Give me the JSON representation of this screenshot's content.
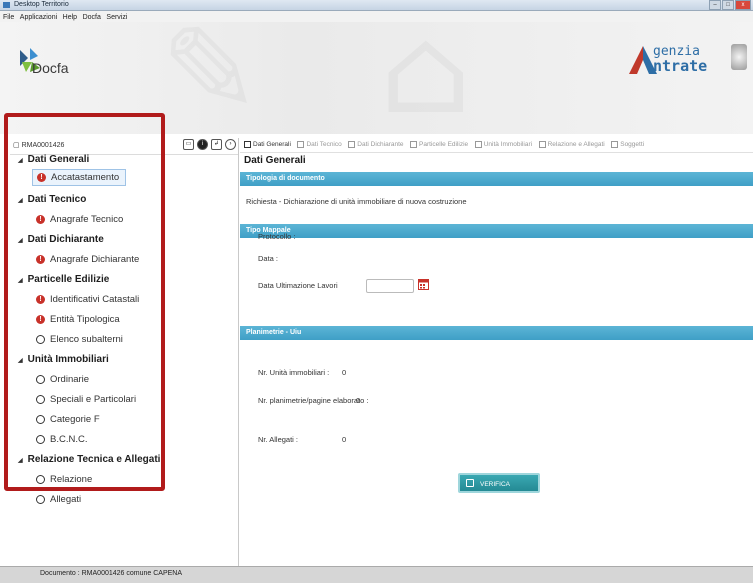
{
  "window": {
    "title": "Desktop Territorio"
  },
  "menu": [
    "File",
    "Applicazioni",
    "Help",
    "Docfa",
    "Servizi"
  ],
  "banner": {
    "app_logo": "Docfa",
    "agency_word1": "genzia",
    "agency_word2": "ntrate"
  },
  "left": {
    "doc_id": "RMA0001426",
    "groups": [
      {
        "label": "Dati Generali",
        "items": [
          {
            "label": "Accatastamento",
            "status": "error",
            "selected": true
          }
        ]
      },
      {
        "label": "Dati Tecnico",
        "items": [
          {
            "label": "Anagrafe Tecnico",
            "status": "error"
          }
        ]
      },
      {
        "label": "Dati Dichiarante",
        "items": [
          {
            "label": "Anagrafe Dichiarante",
            "status": "error"
          }
        ]
      },
      {
        "label": "Particelle Edilizie",
        "items": [
          {
            "label": "Identificativi Catastali",
            "status": "error"
          },
          {
            "label": "Entità Tipologica",
            "status": "error"
          },
          {
            "label": "Elenco subalterni",
            "status": "empty"
          }
        ]
      },
      {
        "label": "Unità Immobiliari",
        "items": [
          {
            "label": "Ordinarie",
            "status": "empty"
          },
          {
            "label": "Speciali e Particolari",
            "status": "empty"
          },
          {
            "label": "Categorie F",
            "status": "empty"
          },
          {
            "label": "B.C.N.C.",
            "status": "empty"
          }
        ]
      },
      {
        "label": "Relazione Tecnica e Allegati",
        "items": [
          {
            "label": "Relazione",
            "status": "empty"
          },
          {
            "label": "Allegati",
            "status": "empty"
          }
        ]
      }
    ]
  },
  "right": {
    "tabs": [
      "Dati Generali",
      "Dati Tecnico",
      "Dati Dichiarante",
      "Particelle Edilizie",
      "Unità Immobiliari",
      "Relazione e Allegati",
      "Soggetti"
    ],
    "section_title": "Dati Generali",
    "bars": {
      "tipologia": "Tipologia di documento",
      "mappale": "Tipo Mappale",
      "planimetrie": "Planimetrie - Uiu"
    },
    "tipologia_text": "Richiesta - Dichiarazione di unità immobiliare di nuova costruzione",
    "protocollo_label": "Protocollo :",
    "data_label": "Data :",
    "data_ult_label": "Data Ultimazione Lavori",
    "nr_unita_label": "Nr. Unità immobiliari :",
    "nr_unita_value": "0",
    "nr_plan_label": "Nr. planimetrie/pagine elaborato :",
    "nr_plan_value": "0",
    "nr_allegati_label": "Nr. Allegati :",
    "nr_allegati_value": "0",
    "verify_button": "VERIFICA SEZIONE"
  },
  "status": {
    "text": "Documento : RMA0001426 comune CAPENA"
  },
  "colors": {
    "section_bar": "#4aa9cf",
    "error_icon": "#c8322a",
    "highlight_box": "#b11b1b",
    "verify_button": "#2c97a1"
  }
}
